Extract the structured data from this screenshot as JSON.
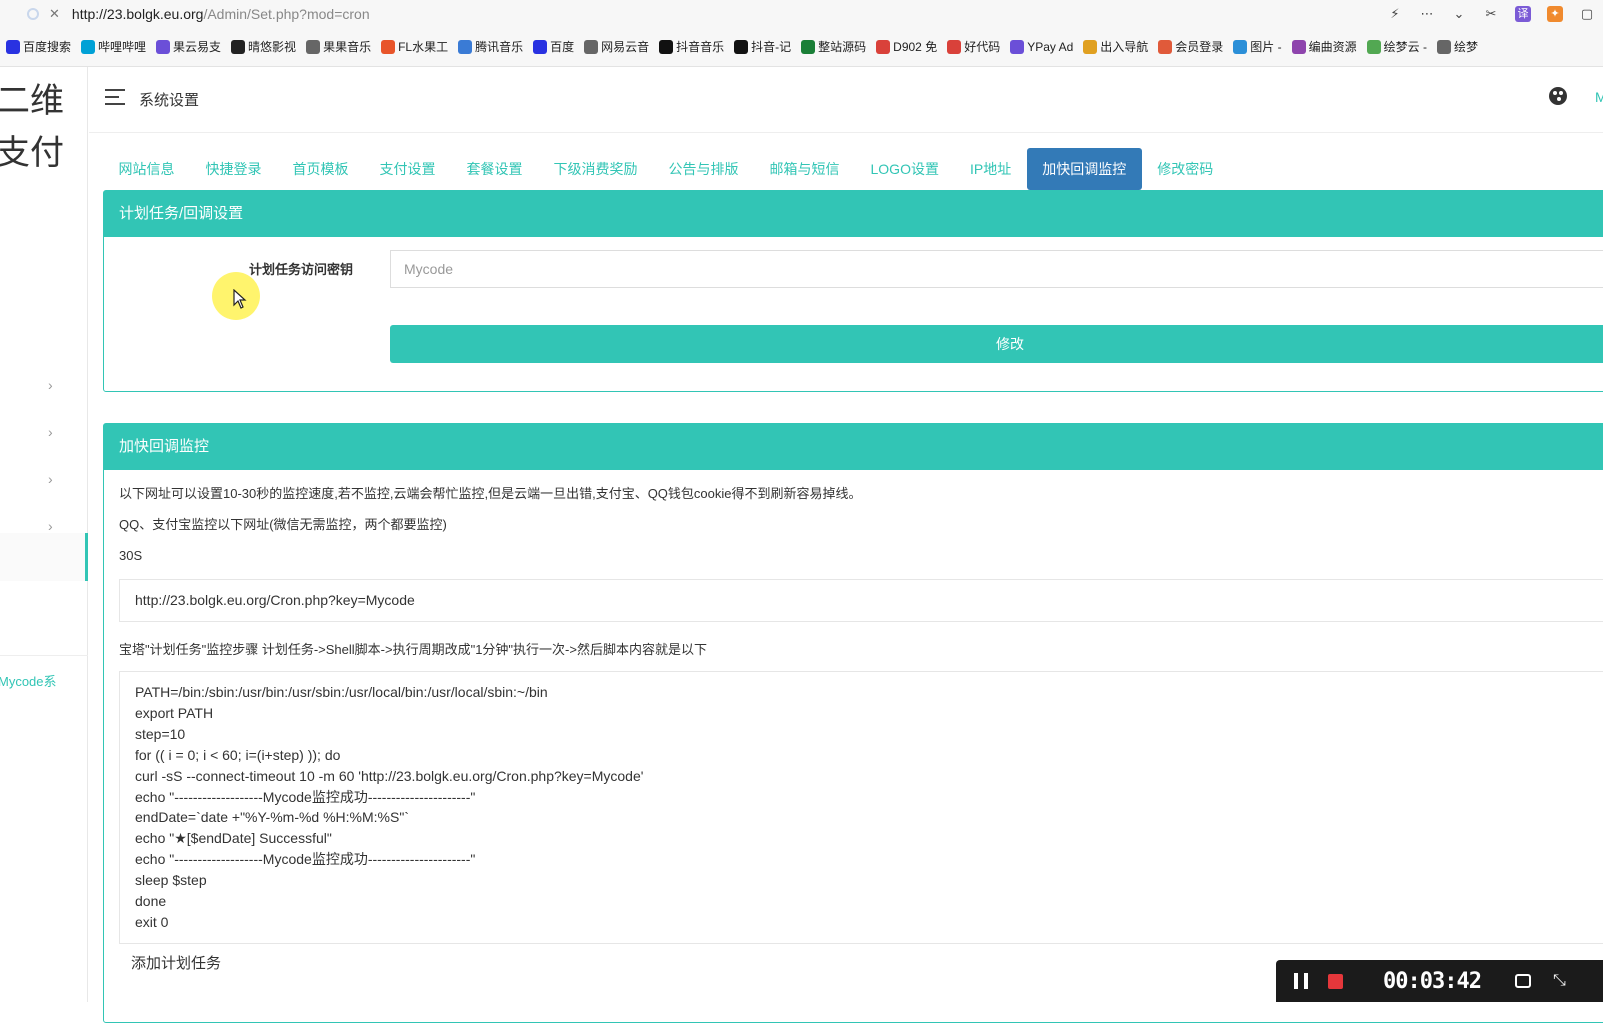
{
  "browser": {
    "url_host": "http://23.bolgk.eu.org",
    "url_path": "/Admin/Set.php?mod=cron",
    "bookmarks": [
      {
        "label": "百度搜索",
        "icon": "paw-icon",
        "color": "#2932e1"
      },
      {
        "label": "哔哩哔哩",
        "icon": "tv-icon",
        "color": "#00a1d6"
      },
      {
        "label": "果云易支",
        "icon": "v-icon",
        "color": "#6b4fd8"
      },
      {
        "label": "晴悠影视",
        "icon": "cat-icon",
        "color": "#222222"
      },
      {
        "label": "果果音乐",
        "icon": "globe-icon",
        "color": "#666666"
      },
      {
        "label": "FL水果工",
        "icon": "fl-icon",
        "color": "#e8552a"
      },
      {
        "label": "腾讯音乐",
        "icon": "music-icon",
        "color": "#3a7bd5"
      },
      {
        "label": "百度",
        "icon": "paw-icon",
        "color": "#2932e1"
      },
      {
        "label": "网易云音",
        "icon": "globe-icon",
        "color": "#666666"
      },
      {
        "label": "抖音音乐",
        "icon": "tiktok-icon",
        "color": "#111111"
      },
      {
        "label": "抖音-记",
        "icon": "tiktok-icon",
        "color": "#111111"
      },
      {
        "label": "整站源码",
        "icon": "play-icon",
        "color": "#1a7f37"
      },
      {
        "label": "D902 免",
        "icon": "shield-icon",
        "color": "#d9413a"
      },
      {
        "label": "好代码",
        "icon": "code-icon",
        "color": "#d9413a"
      },
      {
        "label": "YPay Ad",
        "icon": "v-icon",
        "color": "#6b4fd8"
      },
      {
        "label": "出入导航",
        "icon": "home-icon",
        "color": "#e0a020"
      },
      {
        "label": "会员登录",
        "icon": "sns-icon",
        "color": "#e05a3a"
      },
      {
        "label": "图片 -",
        "icon": "cloud-icon",
        "color": "#2b8fd8"
      },
      {
        "label": "编曲资源",
        "icon": "moon-icon",
        "color": "#8e44ad"
      },
      {
        "label": "绘梦云 -",
        "icon": "leaf-icon",
        "color": "#52a852"
      },
      {
        "label": "绘梦",
        "icon": "globe-icon",
        "color": "#666666"
      }
    ]
  },
  "sidebar": {
    "logo_line1": "二维",
    "logo_line2": "易支付",
    "footer_text": "Mycode系"
  },
  "header": {
    "title": "系统设置",
    "edge_text": "M"
  },
  "tabs": [
    {
      "label": "网站信息",
      "active": false
    },
    {
      "label": "快捷登录",
      "active": false
    },
    {
      "label": "首页模板",
      "active": false
    },
    {
      "label": "支付设置",
      "active": false
    },
    {
      "label": "套餐设置",
      "active": false
    },
    {
      "label": "下级消费奖励",
      "active": false
    },
    {
      "label": "公告与排版",
      "active": false
    },
    {
      "label": "邮箱与短信",
      "active": false
    },
    {
      "label": "LOGO设置",
      "active": false
    },
    {
      "label": "IP地址",
      "active": false
    },
    {
      "label": "加快回调监控",
      "active": true
    },
    {
      "label": "修改密码",
      "active": false
    }
  ],
  "cron_panel": {
    "title": "计划任务/回调设置",
    "key_label": "计划任务访问密钥",
    "key_value": "Mycode",
    "submit_label": "修改"
  },
  "monitor_panel": {
    "title": "加快回调监控",
    "desc1": "以下网址可以设置10-30秒的监控速度,若不监控,云端会帮忙监控,但是云端一旦出错,支付宝、QQ钱包cookie得不到刷新容易掉线。",
    "desc2": "QQ、支付宝监控以下网址(微信无需监控，两个都要监控)",
    "interval": "30S",
    "cron_url": "http://23.bolgk.eu.org/Cron.php?key=Mycode",
    "bt_steps": "宝塔\"计划任务\"监控步骤 计划任务->Shell脚本->执行周期改成\"1分钟\"执行一次->然后脚本内容就是以下",
    "script": "PATH=/bin:/sbin:/usr/bin:/usr/sbin:/usr/local/bin:/usr/local/sbin:~/bin\nexport PATH\nstep=10\nfor (( i = 0; i < 60; i=(i+step) )); do\ncurl -sS --connect-timeout 10 -m 60 'http://23.bolgk.eu.org/Cron.php?key=Mycode'\necho \"-------------------Mycode监控成功----------------------\"\nendDate=`date +\"%Y-%m-%d %H:%M:%S\"`\necho \"★[$endDate] Successful\"\necho \"-------------------Mycode监控成功----------------------\"\nsleep $step\ndone\nexit 0",
    "add_task": "添加计划任务"
  },
  "recorder": {
    "time": "00:03:42"
  },
  "colors": {
    "accent": "#32c5b5",
    "tab_active": "#337ab7",
    "stop": "#e5373b"
  }
}
